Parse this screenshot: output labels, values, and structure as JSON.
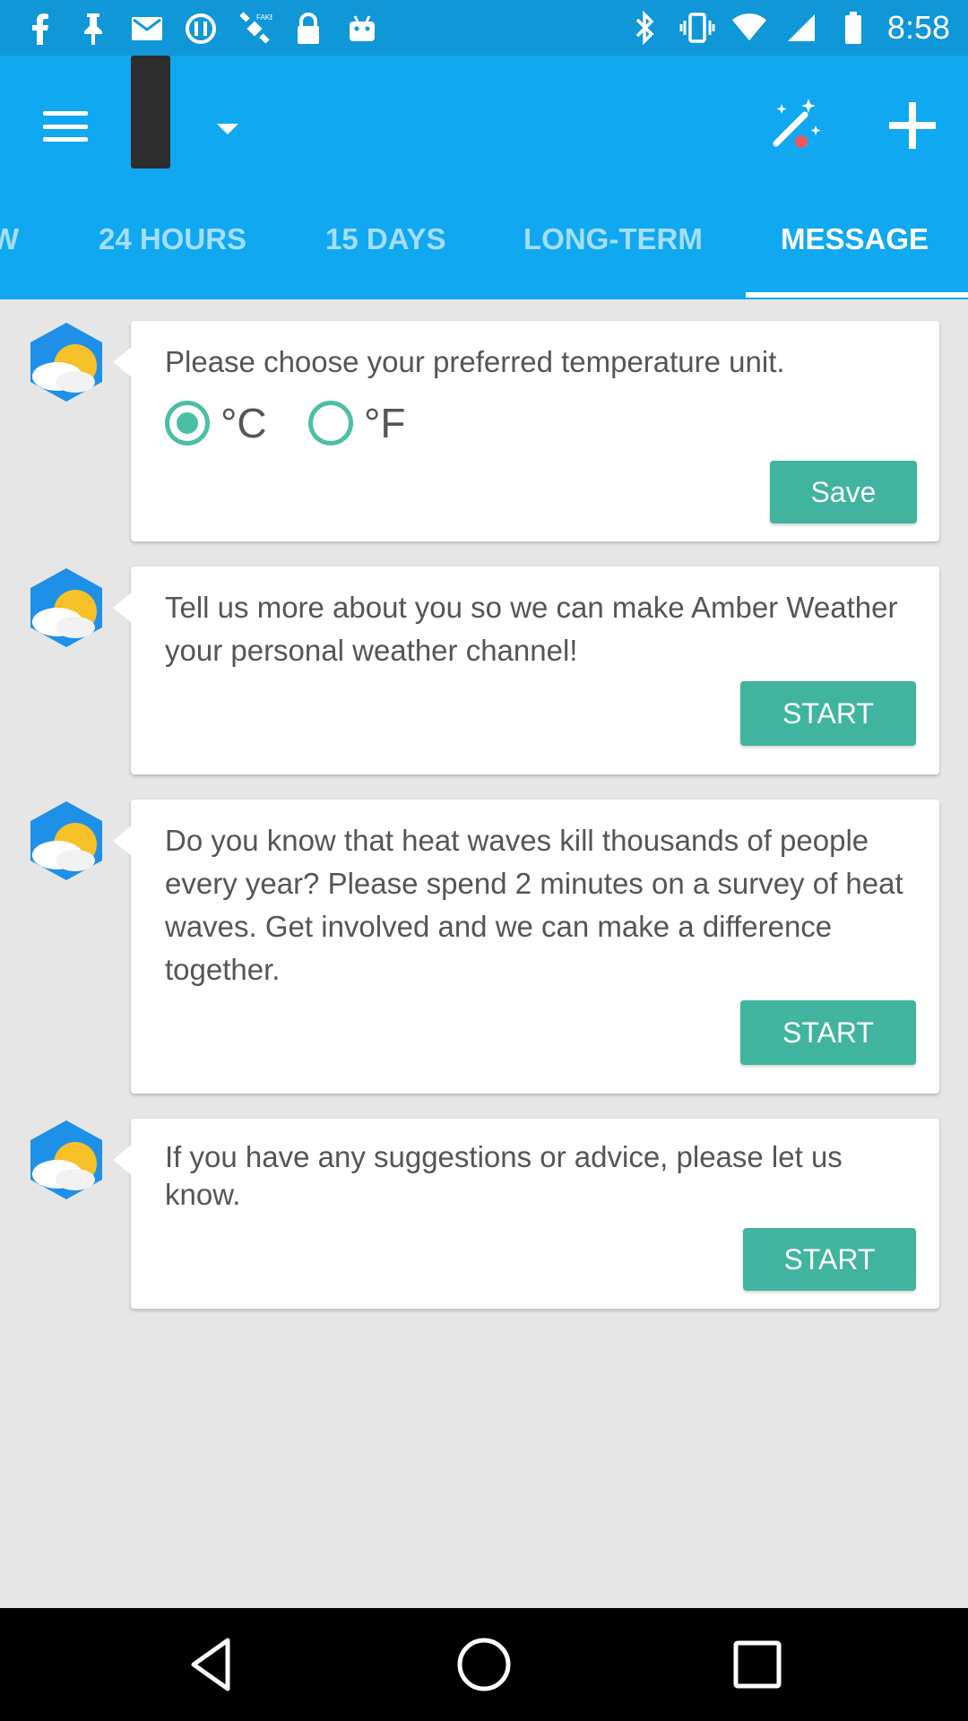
{
  "status_bar": {
    "time": "8:58",
    "left_icons": [
      "facebook-icon",
      "notification-pin-icon",
      "gmail-icon",
      "fake-gps-icon",
      "location-satellite-icon",
      "lock-icon",
      "android-icon"
    ],
    "right_icons": [
      "bluetooth-icon",
      "vibrate-icon",
      "wifi-icon",
      "signal-icon",
      "battery-icon"
    ]
  },
  "app_bar": {
    "actions": [
      "menu-icon",
      "dropdown-icon",
      "magic-wand-icon",
      "add-icon"
    ],
    "tabs": [
      {
        "label": "W",
        "active": false
      },
      {
        "label": "24 HOURS",
        "active": false
      },
      {
        "label": "15 DAYS",
        "active": false
      },
      {
        "label": "LONG-TERM",
        "active": false
      },
      {
        "label": "MESSAGE",
        "active": true
      }
    ]
  },
  "messages": [
    {
      "text": "Please choose your preferred temperature unit.",
      "options": [
        {
          "label": "°C",
          "checked": true
        },
        {
          "label": "°F",
          "checked": false
        }
      ],
      "button": "Save"
    },
    {
      "text": "Tell us more about you so we can make Amber Weather your personal weather channel!",
      "button": "START"
    },
    {
      "text": "Do you know that heat waves kill thousands of people every year? Please spend 2 minutes on a survey of heat waves. Get involved and we can make a difference together.",
      "button": "START"
    },
    {
      "text": "If you have any suggestions or advice, please let us know.",
      "button": "START"
    }
  ],
  "colors": {
    "status_bar": "#0f97d8",
    "app_bar": "#10a8f1",
    "button": "#40b49f",
    "background": "#e6e6e6"
  }
}
